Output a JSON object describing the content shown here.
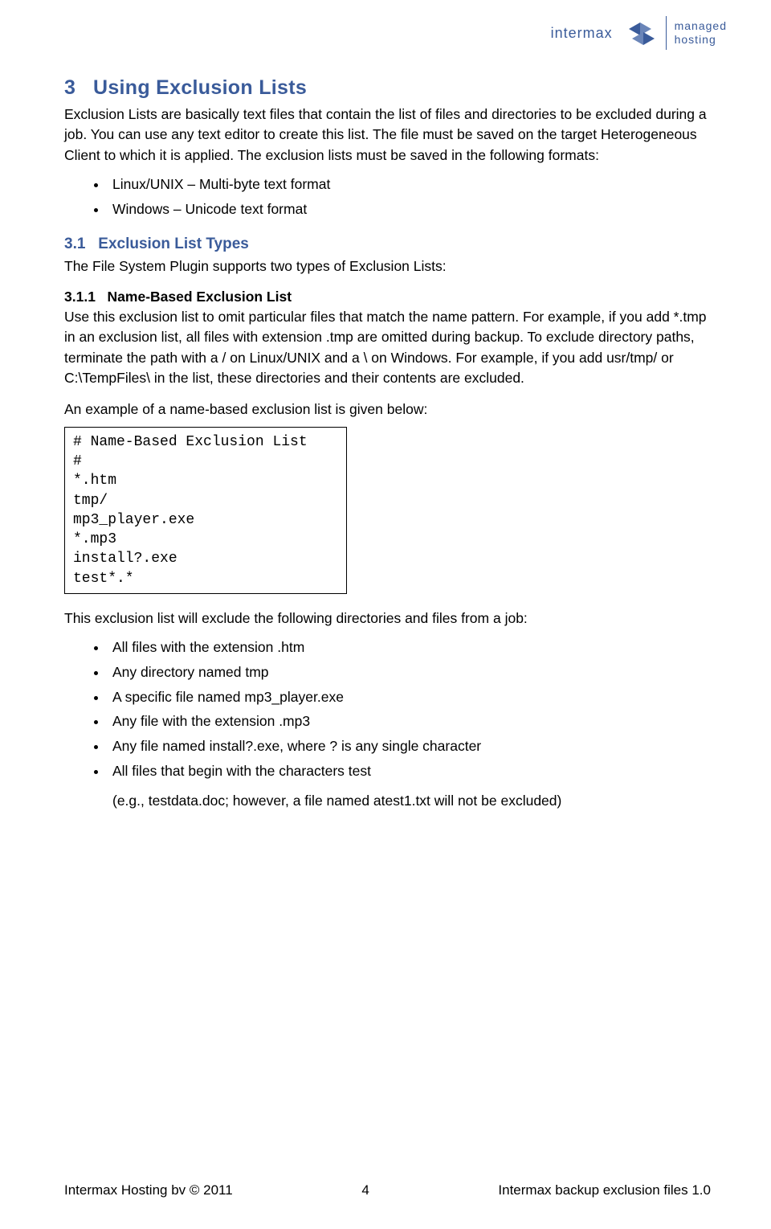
{
  "logo": {
    "left": "intermax",
    "right_line1": "managed",
    "right_line2": "hosting"
  },
  "section": {
    "num": "3",
    "title": "Using Exclusion Lists",
    "intro": "Exclusion Lists are basically text files that contain the list of files and directories to be excluded during a job. You can use any text editor to create this list. The file must be saved on the target Heterogeneous Client to which it is applied. The exclusion lists must be saved in the following formats:",
    "formats": [
      "Linux/UNIX – Multi-byte text format",
      "Windows – Unicode text format"
    ]
  },
  "sub": {
    "num": "3.1",
    "title": "Exclusion List Types",
    "intro": "The File System Plugin supports two types of Exclusion Lists:"
  },
  "subsub": {
    "num": "3.1.1",
    "title": "Name-Based Exclusion List",
    "p1": "Use this exclusion list to omit particular files that match the name pattern. For example, if you add *.tmp in an exclusion list, all files with extension .tmp are omitted during backup. To exclude directory paths, terminate the path with a / on Linux/UNIX and a \\ on Windows. For example, if you add usr/tmp/ or C:\\TempFiles\\ in the list, these directories and their contents are excluded.",
    "p2": "An example of a name-based exclusion list is given below:",
    "code": "# Name-Based Exclusion List\n#\n*.htm\ntmp/\nmp3_player.exe\n*.mp3\ninstall?.exe\ntest*.*",
    "p3": "This exclusion list will exclude the following directories and files from a job:",
    "items": [
      "All files with the extension .htm",
      "Any directory named tmp",
      "A specific file named mp3_player.exe",
      "Any file with the extension .mp3",
      "Any file named install?.exe, where ? is any single character",
      "All files that begin with the characters test"
    ],
    "note": "(e.g., testdata.doc; however, a file named atest1.txt will not be excluded)"
  },
  "footer": {
    "left": "Intermax Hosting bv © 2011",
    "center": "4",
    "right": "Intermax backup exclusion files 1.0"
  }
}
